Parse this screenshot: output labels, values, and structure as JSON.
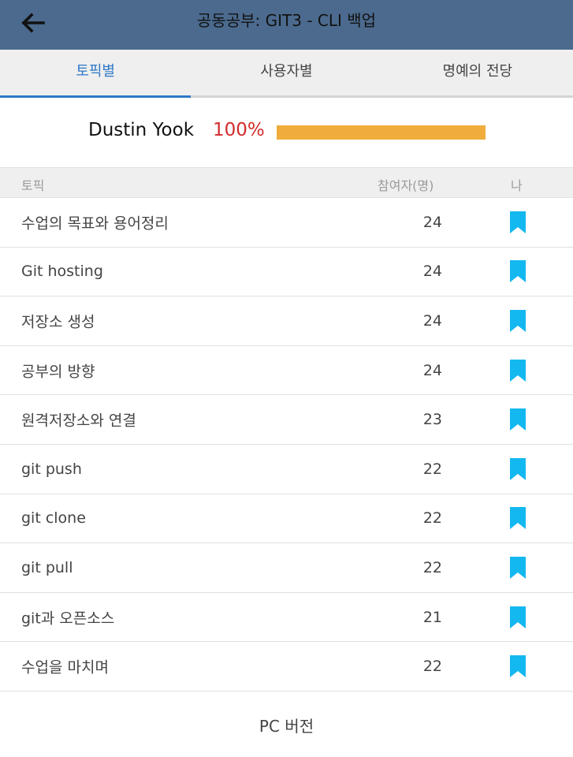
{
  "header": {
    "back_icon": "arrow-left-icon",
    "title": "공동공부: GIT3 - CLI 백업"
  },
  "tabs": [
    {
      "label": "토픽별",
      "active": true
    },
    {
      "label": "사용자별",
      "active": false
    },
    {
      "label": "명예의 전당",
      "active": false
    }
  ],
  "user": {
    "name": "Dustin Yook",
    "percent_text": "100%",
    "progress": 1.0
  },
  "table": {
    "columns": {
      "topic": "토픽",
      "count": "참여자(명)",
      "me": "나"
    },
    "rows": [
      {
        "title": "수업의 목표와 용어정리",
        "count": "24",
        "icon": "bookmark-icon"
      },
      {
        "title": "Git hosting",
        "count": "24",
        "icon": "bookmark-icon"
      },
      {
        "title": "저장소 생성",
        "count": "24",
        "icon": "bookmark-icon"
      },
      {
        "title": "공부의 방향",
        "count": "24",
        "icon": "bookmark-icon"
      },
      {
        "title": "원격저장소와 연결",
        "count": "23",
        "icon": "bookmark-icon"
      },
      {
        "title": "git push",
        "count": "22",
        "icon": "bookmark-icon"
      },
      {
        "title": "git clone",
        "count": "22",
        "icon": "bookmark-icon"
      },
      {
        "title": "git pull",
        "count": "22",
        "icon": "bookmark-icon"
      },
      {
        "title": "git과 오픈소스",
        "count": "21",
        "icon": "bookmark-icon"
      },
      {
        "title": "수업을 마치며",
        "count": "22",
        "icon": "bookmark-icon"
      }
    ]
  },
  "footer": {
    "pc_version_label": "PC 버전"
  },
  "colors": {
    "appbar": "#4b6a8e",
    "tab_active": "#2f78c8",
    "percent": "#d22b2b",
    "progress": "#f0ad3b",
    "bookmark": "#14b8f0"
  }
}
